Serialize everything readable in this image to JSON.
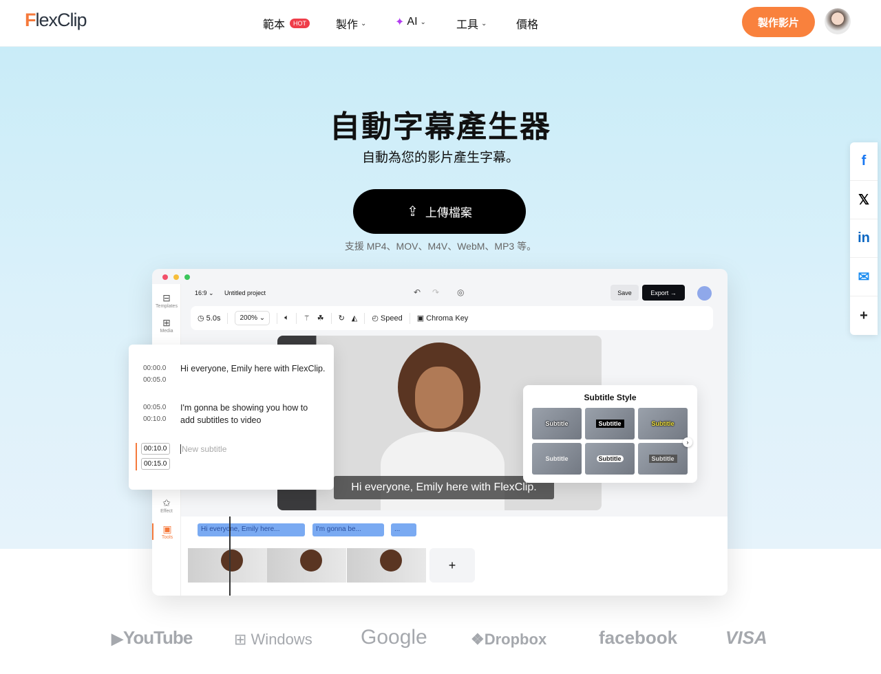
{
  "nav": {
    "logo_prefix": "F",
    "logo_rest": "lexClip",
    "items": [
      {
        "label": "範本",
        "badge": "HOT"
      },
      {
        "label": "製作"
      },
      {
        "label": "AI"
      },
      {
        "label": "工具"
      },
      {
        "label": "價格"
      }
    ],
    "cta": "製作影片"
  },
  "hero": {
    "title": "自動字幕產生器",
    "subtitle": "自動為您的影片產生字幕。",
    "upload": "上傳檔案",
    "formats": "支援 MP4、MOV、M4V、WebM、MP3 等。"
  },
  "editor": {
    "sidebar": [
      "Templates",
      "Media",
      "Effect",
      "Tools"
    ],
    "ratio": "16:9",
    "project": "Untitled project",
    "save": "Save",
    "export": "Export →",
    "duration": "5.0s",
    "zoom": "200%",
    "speed": "Speed",
    "chroma": "Chroma Key",
    "caption": "Hi everyone, Emily here with FlexClip.",
    "transcript": [
      {
        "start": "00:00.0",
        "end": "00:05.0",
        "text": "Hi everyone, Emily here with FlexClip."
      },
      {
        "start": "00:05.0",
        "end": "00:10.0",
        "text": "I'm gonna be showing you how to add subtitles to video"
      }
    ],
    "new_start": "00:10.0",
    "new_end": "00:15.0",
    "new_placeholder": "New subtitle",
    "timeline_chips": [
      "Hi everyone, Emily here...",
      "I'm gonna be...",
      "..."
    ],
    "add": "+",
    "style_title": "Subtitle Style",
    "style_tiles": [
      "Subtitle",
      "Subtitle",
      "Subtitle",
      "Subtitle",
      "Subtitle",
      "Subtitle"
    ]
  },
  "share": [
    "f",
    "𝕏",
    "in",
    "✉",
    "+"
  ],
  "brands": [
    "YouTube",
    "Windows",
    "Google",
    "Dropbox",
    "facebook",
    "VISA"
  ],
  "colors": {
    "accent": "#f9813d",
    "hot": "#ef3e4a",
    "chip": "#7aaaf2"
  }
}
